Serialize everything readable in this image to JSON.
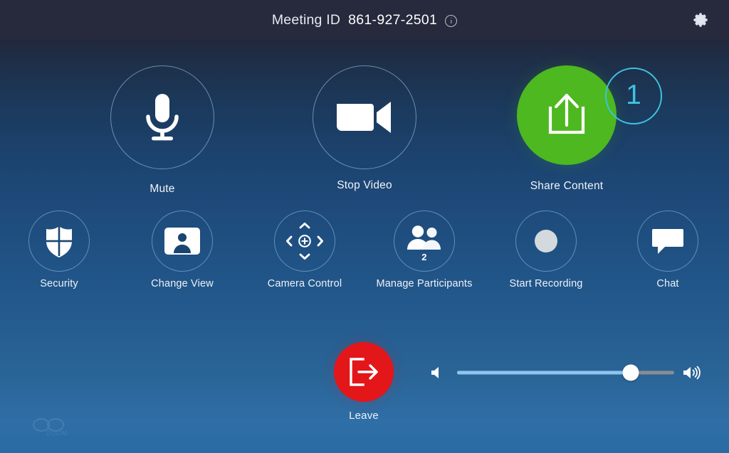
{
  "header": {
    "meeting_id_label": "Meeting ID",
    "meeting_id_value": "861-927-2501",
    "info_icon": "info-icon",
    "settings_icon": "gear-icon"
  },
  "primary_controls": [
    {
      "id": "mute",
      "label": "Mute",
      "icon": "microphone-icon",
      "state": "unmuted"
    },
    {
      "id": "stop-video",
      "label": "Stop Video",
      "icon": "video-camera-icon",
      "state": "video-on"
    },
    {
      "id": "share-content",
      "label": "Share Content",
      "icon": "share-upload-icon",
      "state": "highlighted"
    }
  ],
  "annotation": {
    "number": "1",
    "color": "#3dc3e0"
  },
  "secondary_controls": [
    {
      "id": "security",
      "label": "Security",
      "icon": "shield-icon"
    },
    {
      "id": "change-view",
      "label": "Change View",
      "icon": "person-card-icon"
    },
    {
      "id": "camera-control",
      "label": "Camera Control",
      "icon": "pan-tilt-arrows-icon"
    },
    {
      "id": "manage-participants",
      "label": "Manage Participants",
      "icon": "people-icon",
      "badge": "2"
    },
    {
      "id": "start-recording",
      "label": "Start Recording",
      "icon": "record-dot-icon"
    },
    {
      "id": "chat",
      "label": "Chat",
      "icon": "chat-bubble-icon"
    }
  ],
  "leave": {
    "label": "Leave",
    "icon": "exit-arrow-icon",
    "color": "#e3161a"
  },
  "volume": {
    "value": 80,
    "min_icon": "volume-low-icon",
    "max_icon": "volume-high-icon",
    "fill_color": "#8ec6f0",
    "track_color": "#8b8d90"
  },
  "watermark": {
    "text": "ZOOM"
  },
  "theme": {
    "header_bg": "#272a3c",
    "accent_green": "#4db81f",
    "circle_stroke": "rgba(150,195,232,.6)"
  }
}
